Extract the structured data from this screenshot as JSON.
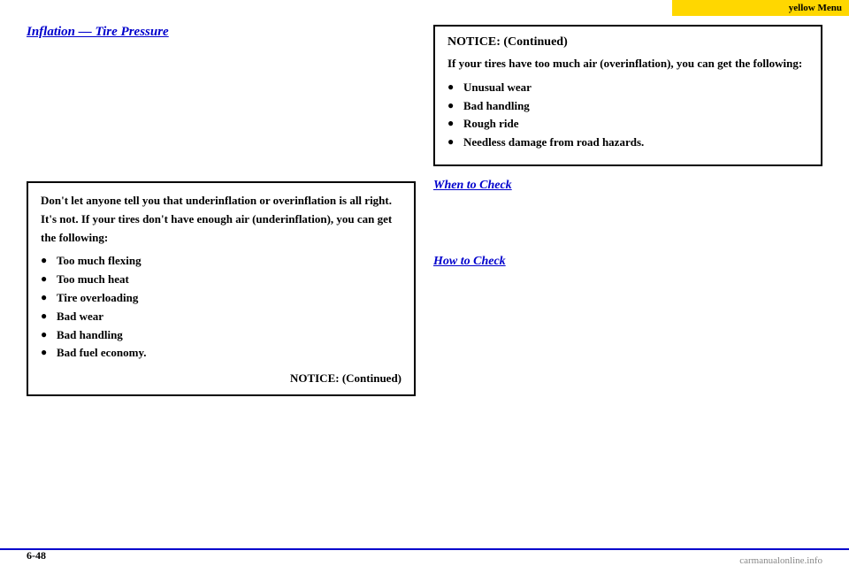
{
  "topbar": {
    "label": "yellow Menu"
  },
  "left": {
    "heading": "Inflation — Tire Pressure",
    "body1": "",
    "notice_box": {
      "title": "NOTICE: (Continued)",
      "intro": "Don't let anyone tell you that underinflation or overinflation is all right. It's not. If your tires don't have enough air (underinflation), you can get the following:",
      "bullets": [
        "Too much flexing",
        "Too much heat",
        "Tire overloading",
        "Bad wear",
        "Bad handling",
        "Bad fuel economy."
      ],
      "continued": "NOTICE: (Continued)"
    }
  },
  "right": {
    "notice_box": {
      "title": "NOTICE: (Continued)",
      "intro": "If your tires have too much air (overinflation), you can get the following:",
      "bullets": [
        "Unusual wear",
        "Bad handling",
        "Rough ride",
        "Needless damage from road hazards."
      ]
    },
    "when_to_check": {
      "heading": "When to Check",
      "body": ""
    },
    "how_to_check": {
      "heading": "How to Check",
      "body": ""
    }
  },
  "bottom": {
    "page_number": "6-48",
    "watermark": "carmanualonline.info"
  }
}
